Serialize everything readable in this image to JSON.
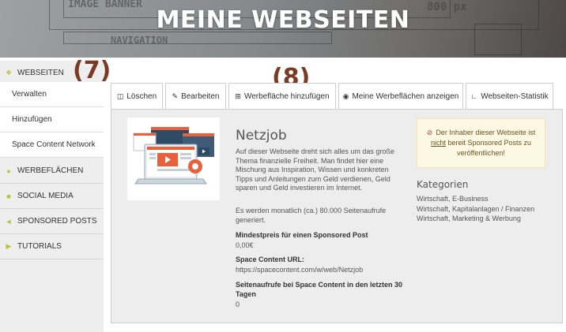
{
  "banner": {
    "title": "MEINE WEBSEITEN",
    "sketch": {
      "image_banner": "IMAGE BANNER",
      "px": "800 px",
      "navigation": "NAVIGATION"
    }
  },
  "callouts": {
    "sidebar": "(7)",
    "tabs": "(8)"
  },
  "sidebar": {
    "webseiten": {
      "label": "WEBSEITEN",
      "icon": "sitemap-icon"
    },
    "sub": [
      "Verwalten",
      "Hinzufügen",
      "Space Content Network"
    ],
    "werbeflaechen": {
      "label": "WERBEFLÄCHEN",
      "icon": "map-marker-icon"
    },
    "social_media": {
      "label": "SOCIAL MEDIA",
      "icon": "users-icon"
    },
    "sponsored_posts": {
      "label": "SPONSORED POSTS",
      "icon": "bullhorn-icon"
    },
    "tutorials": {
      "label": "TUTORIALS",
      "icon": "video-camera-icon"
    },
    "accent_color": "#b5c43a"
  },
  "tabs": {
    "loeschen": "Löschen",
    "bearbeiten": "Bearbeiten",
    "werbeflaeche_hinzufuegen": "Werbefläche hinzufügen",
    "werbeflaechen_anzeigen": "Meine Werbeflächen anzeigen",
    "statistik": "Webseiten-Statistik"
  },
  "site": {
    "title": "Netzjob",
    "description": "Auf dieser Webseite dreht sich alles um das große Thema finanzielle Freiheit. Man findet hier eine Mischung aus Inspiration, Wissen und konkreten Tipps und Anleitungen zum Geld verdienen, Geld sparen und Geld investieren im Internet.",
    "monthly_views": "Es werden monatlich (ca.) 80.000 Seitenaufrufe generiert.",
    "min_price_label": "Mindestpreis für einen Sponsored Post",
    "min_price_value": "0,00€",
    "url_label": "Space Content URL:",
    "url_value": "https://spacecontent.com/w/web/Netzjob",
    "views_label": "Seitenaufrufe bei Space Content in den letzten 30 Tagen",
    "views_value": "0"
  },
  "notice": {
    "pre": "Der Inhaber dieser Webseite ist",
    "underlined": "nicht",
    "post": "bereit Sponsored Posts zu veröffentlichen!",
    "icon": "ban-icon"
  },
  "categories": {
    "title": "Kategorien",
    "items": [
      "Wirtschaft, E-Business",
      "Wirtschaft, Kapitalanlagen / Finanzen",
      "Wirtschaft, Marketing & Werbung"
    ]
  }
}
